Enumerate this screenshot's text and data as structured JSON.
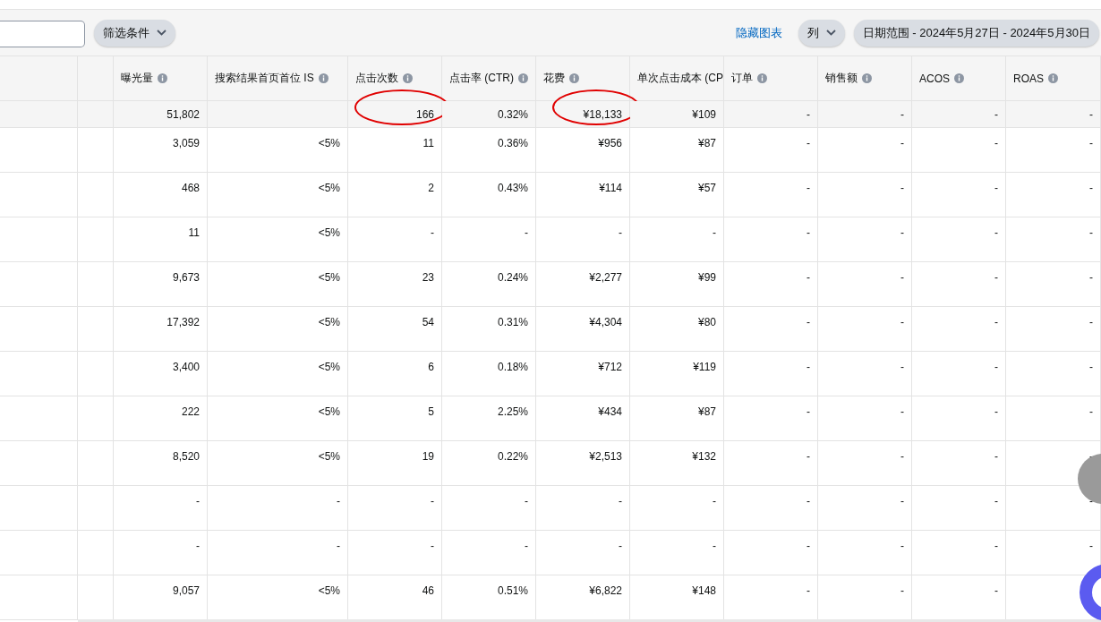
{
  "toolbar": {
    "filter_button": "筛选条件",
    "hide_chart_link": "隐藏图表",
    "columns_button": "列",
    "date_range_button": "日期范围 - 2024年5月27日 - 2024年5月30日"
  },
  "table": {
    "columns": [
      {
        "label": "曝光量",
        "info": true
      },
      {
        "label": "搜索结果首页首位 IS",
        "info": true
      },
      {
        "label": "点击次数",
        "info": true
      },
      {
        "label": "点击率 (CTR)",
        "info": true
      },
      {
        "label": "花费",
        "info": true
      },
      {
        "label": "单次点击成本 (CP",
        "info": false
      },
      {
        "label": "订单",
        "info": true
      },
      {
        "label": "销售额",
        "info": true
      },
      {
        "label": "ACOS",
        "info": true
      },
      {
        "label": "ROAS",
        "info": true
      }
    ],
    "total_row": [
      {
        "text": "51,802",
        "circled": false
      },
      {
        "circled": false
      },
      {
        "text": "166",
        "circled": true
      },
      {
        "text": "0.32%",
        "circled": false
      },
      {
        "text": "¥18,133",
        "circled": true
      },
      {
        "text": "¥109",
        "circled": false
      },
      {
        "text": "-",
        "circled": false
      },
      {
        "text": "-",
        "circled": false
      },
      {
        "text": "-",
        "circled": false
      },
      {
        "text": "-",
        "circled": false
      }
    ],
    "rows": [
      [
        "3,059",
        "<5%",
        "11",
        "0.36%",
        "¥956",
        "¥87",
        "-",
        "-",
        "-",
        "-"
      ],
      [
        "468",
        "<5%",
        "2",
        "0.43%",
        "¥114",
        "¥57",
        "-",
        "-",
        "-",
        "-"
      ],
      [
        "11",
        "<5%",
        "-",
        "-",
        "-",
        "-",
        "-",
        "-",
        "-",
        "-"
      ],
      [
        "9,673",
        "<5%",
        "23",
        "0.24%",
        "¥2,277",
        "¥99",
        "-",
        "-",
        "-",
        "-"
      ],
      [
        "17,392",
        "<5%",
        "54",
        "0.31%",
        "¥4,304",
        "¥80",
        "-",
        "-",
        "-",
        "-"
      ],
      [
        "3,400",
        "<5%",
        "6",
        "0.18%",
        "¥712",
        "¥119",
        "-",
        "-",
        "-",
        "-"
      ],
      [
        "222",
        "<5%",
        "5",
        "2.25%",
        "¥434",
        "¥87",
        "-",
        "-",
        "-",
        "-"
      ],
      [
        "8,520",
        "<5%",
        "19",
        "0.22%",
        "¥2,513",
        "¥132",
        "-",
        "-",
        "-",
        "-"
      ],
      [
        "-",
        "-",
        "-",
        "-",
        "-",
        "-",
        "-",
        "-",
        "-",
        "-"
      ],
      [
        "-",
        "-",
        "-",
        "-",
        "-",
        "-",
        "-",
        "-",
        "-",
        "-"
      ],
      [
        "9,057",
        "<5%",
        "46",
        "0.51%",
        "¥6,822",
        "¥148",
        "-",
        "-",
        "-"
      ]
    ]
  }
}
